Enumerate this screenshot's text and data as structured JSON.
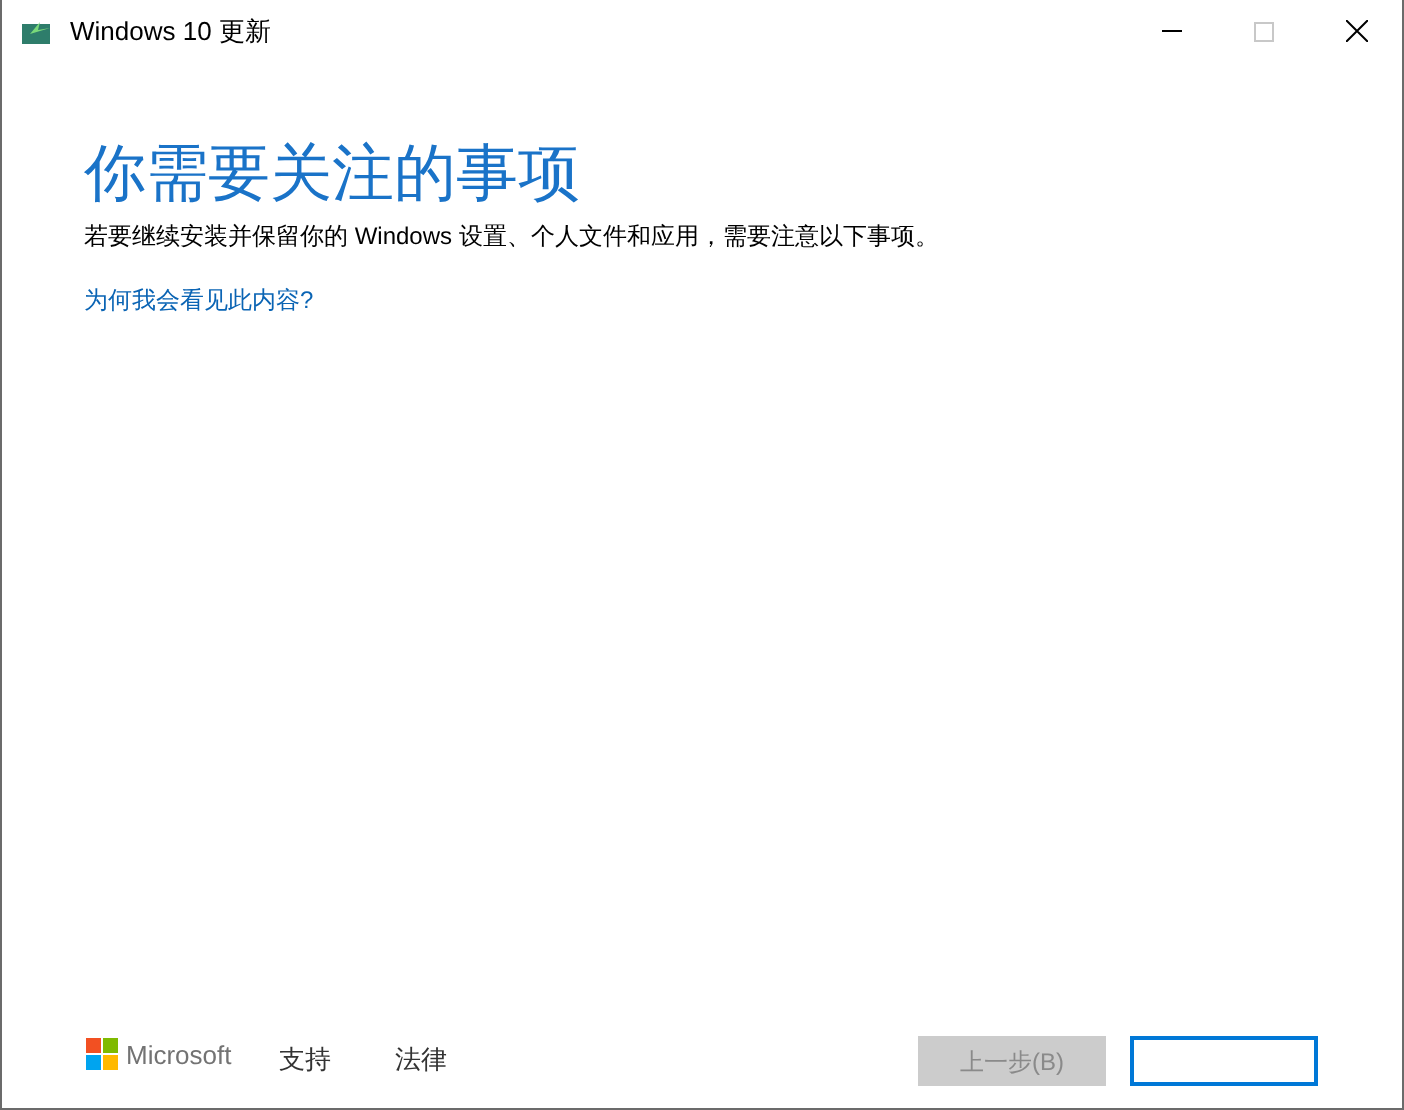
{
  "window": {
    "title": "Windows 10 更新"
  },
  "heading": "你需要关注的事项",
  "description": "若要继续安装并保留你的 Windows 设置、个人文件和应用，需要注意以下事项。",
  "help_link": "为何我会看见此内容?",
  "footer": {
    "brand": "Microsoft",
    "links": [
      "支持",
      "法律"
    ]
  },
  "buttons": [
    {
      "label": "上一步(B)",
      "disabled": true
    },
    {
      "disabled": false
    }
  ]
}
